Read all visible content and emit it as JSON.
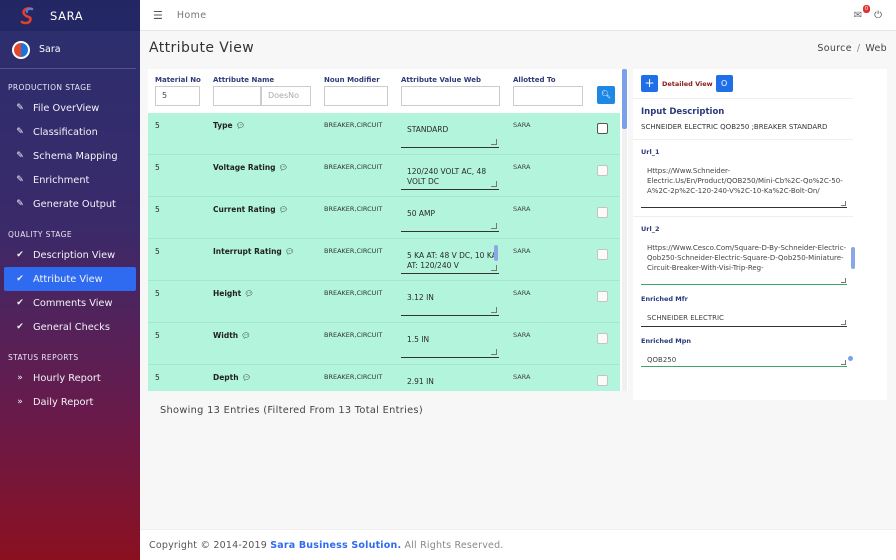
{
  "app": {
    "name": "SARA",
    "user": "Sara"
  },
  "topbar": {
    "breadcrumb_home": "Home",
    "notification_count": "0"
  },
  "sidebar": {
    "sections": [
      {
        "title": "PRODUCTION STAGE",
        "items": [
          {
            "label": "File OverView",
            "icon": "edit-icon"
          },
          {
            "label": "Classification",
            "icon": "edit-icon"
          },
          {
            "label": "Schema Mapping",
            "icon": "edit-icon"
          },
          {
            "label": "Enrichment",
            "icon": "edit-icon"
          },
          {
            "label": "Generate Output",
            "icon": "edit-icon"
          }
        ]
      },
      {
        "title": "QUALITY STAGE",
        "items": [
          {
            "label": "Description View",
            "icon": "check-icon"
          },
          {
            "label": "Attribute View",
            "icon": "check-icon",
            "active": true
          },
          {
            "label": "Comments View",
            "icon": "check-icon"
          },
          {
            "label": "General Checks",
            "icon": "check-icon"
          }
        ]
      },
      {
        "title": "STATUS REPORTS",
        "items": [
          {
            "label": "Hourly Report",
            "icon": "double-chevron-icon"
          },
          {
            "label": "Daily Report",
            "icon": "double-chevron-icon"
          }
        ]
      }
    ]
  },
  "page": {
    "title": "Attribute View",
    "crumb_source": "Source",
    "crumb_web": "Web"
  },
  "table": {
    "headers": {
      "material_no": "Material No",
      "attribute_name": "Attribute Name",
      "noun_modifier": "Noun Modifier",
      "attribute_value_web": "Attribute Value Web",
      "allotted_to": "Allotted To"
    },
    "filters": {
      "material_no": "5",
      "attribute_name": "",
      "attribute_name_placeholder": "DoesNo",
      "noun_modifier": "",
      "attribute_value_web": "",
      "allotted_to": ""
    },
    "rows": [
      {
        "mat": "5",
        "attr": "Type",
        "noun": "BREAKER,CIRCUIT",
        "val": "STANDARD",
        "allot": "SARA",
        "checked_visible": true
      },
      {
        "mat": "5",
        "attr": "Voltage Rating",
        "noun": "BREAKER,CIRCUIT",
        "val": "120/240 VOLT AC, 48 VOLT DC",
        "allot": "SARA"
      },
      {
        "mat": "5",
        "attr": "Current Rating",
        "noun": "BREAKER,CIRCUIT",
        "val": "50 AMP",
        "allot": "SARA"
      },
      {
        "mat": "5",
        "attr": "Interrupt Rating",
        "noun": "BREAKER,CIRCUIT",
        "val": "5 KA AT: 48 V DC, 10 KA AT: 120/240 V",
        "allot": "SARA"
      },
      {
        "mat": "5",
        "attr": "Height",
        "noun": "BREAKER,CIRCUIT",
        "val": "3.12 IN",
        "allot": "SARA"
      },
      {
        "mat": "5",
        "attr": "Width",
        "noun": "BREAKER,CIRCUIT",
        "val": "1.5 IN",
        "allot": "SARA"
      },
      {
        "mat": "5",
        "attr": "Depth",
        "noun": "BREAKER,CIRCUIT",
        "val": "2.91 IN",
        "allot": "SARA"
      }
    ],
    "showing": "Showing 13 Entries (Filtered From 13 Total Entries)"
  },
  "detail": {
    "title": "Detailed View",
    "o_button": "O",
    "input_description_label": "Input Description",
    "input_description": "SCHNEIDER ELECTRIC QOB250 ;BREAKER STANDARD",
    "url1_label": "Url_1",
    "url1": "Https://Www.Schneider-Electric.Us/En/Product/QOB250/Mini-Cb%2C-Qo%2C-50-A%2C-2p%2C-120-240-V%2C-10-Ka%2C-Bolt-On/",
    "url2_label": "Url_2",
    "url2": "Https://Www.Cesco.Com/Square-D-By-Schneider-Electric-Qob250-Schneider-Electric-Square-D-Qob250-Miniature-Circuit-Breaker-With-Visi-Trip-Reg-",
    "mfr_label": "Enriched Mfr",
    "mfr": "SCHNEIDER ELECTRIC",
    "mpn_label": "Enriched Mpn",
    "mpn": "QOB250"
  },
  "footer": {
    "copyright": "Copyright © 2014-2019",
    "company": "Sara Business Solution.",
    "rights": "All Rights Reserved."
  }
}
